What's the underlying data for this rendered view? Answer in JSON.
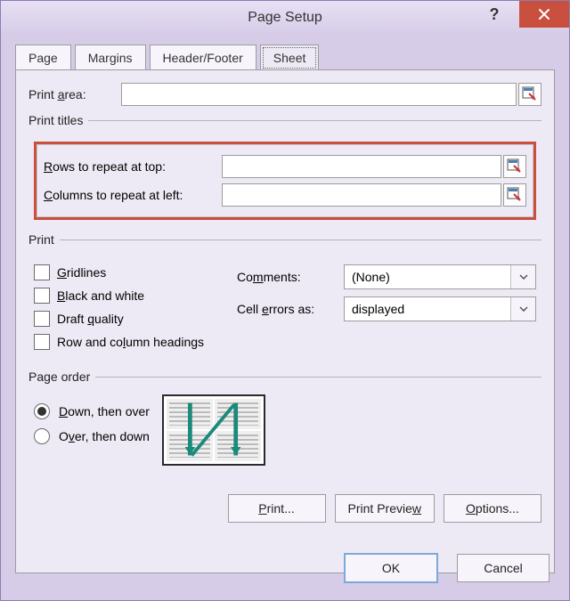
{
  "window": {
    "title": "Page Setup"
  },
  "tabs": {
    "page": "Page",
    "margins": "Margins",
    "header_footer": "Header/Footer",
    "sheet": "Sheet",
    "active": "sheet"
  },
  "print_area": {
    "label": "Print area:",
    "value": ""
  },
  "print_titles": {
    "legend": "Print titles",
    "rows_label": "Rows to repeat at top:",
    "rows_value": "",
    "cols_label": "Columns to repeat at left:",
    "cols_value": ""
  },
  "print": {
    "legend": "Print",
    "gridlines": "Gridlines",
    "bw": "Black and white",
    "draft": "Draft quality",
    "rowcol_headings": "Row and column headings",
    "comments_label": "Comments:",
    "comments_value": "(None)",
    "cellerrors_label": "Cell errors as:",
    "cellerrors_value": "displayed"
  },
  "page_order": {
    "legend": "Page order",
    "down_over": "Down, then over",
    "over_down": "Over, then down",
    "selected": "down_over"
  },
  "buttons": {
    "print": "Print...",
    "preview": "Print Preview",
    "options": "Options...",
    "ok": "OK",
    "cancel": "Cancel"
  }
}
